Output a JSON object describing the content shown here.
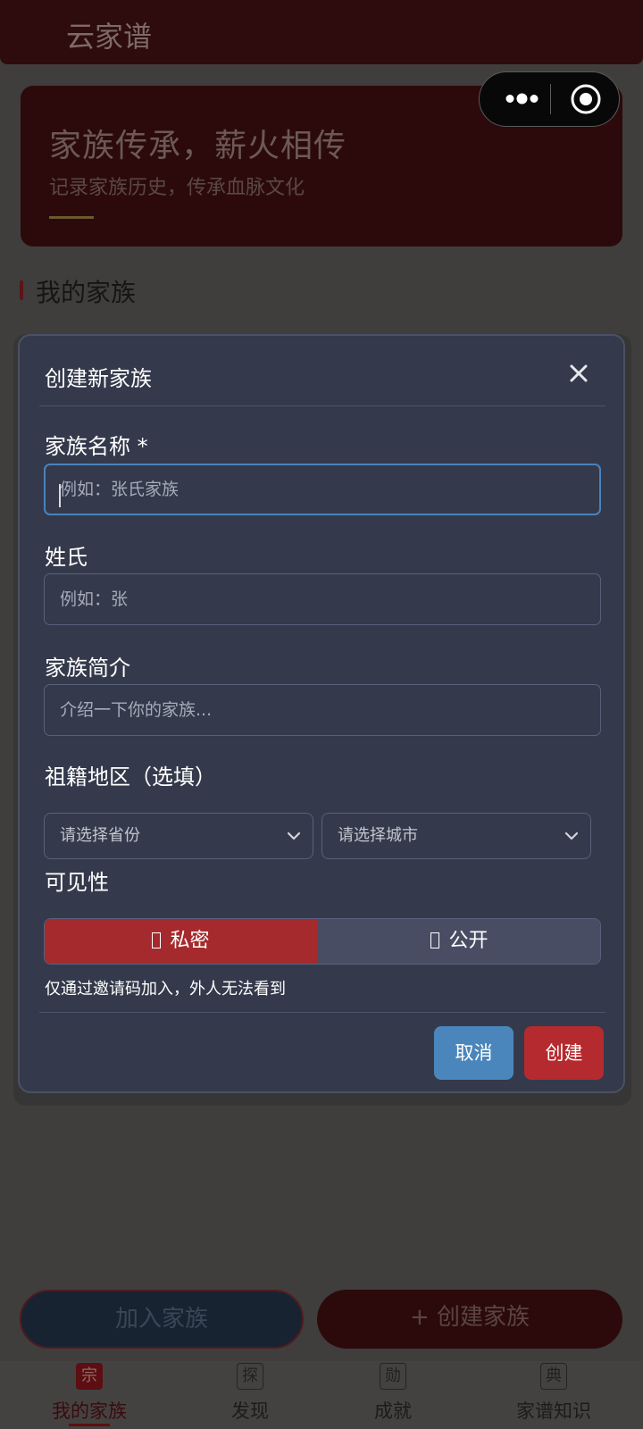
{
  "app": {
    "title": "云家谱"
  },
  "hero": {
    "title": "家族传承，薪火相传",
    "subtitle": "记录家族历史，传承血脉文化"
  },
  "section": {
    "title": "我的家族"
  },
  "modal": {
    "title": "创建新家族",
    "fields": {
      "name": {
        "label": "家族名称 *",
        "placeholder": "例如：张氏家族",
        "value": ""
      },
      "surname": {
        "label": "姓氏",
        "placeholder": "例如：张",
        "value": ""
      },
      "intro": {
        "label": "家族简介",
        "placeholder": "介绍一下你的家族...",
        "value": ""
      },
      "region": {
        "label": "祖籍地区（选填）",
        "province_placeholder": "请选择省份",
        "city_placeholder": "请选择城市"
      },
      "visibility": {
        "label": "可见性",
        "options": [
          "私密",
          "公开"
        ],
        "selected": "私密",
        "hint": "仅通过邀请码加入，外人无法看到"
      }
    },
    "buttons": {
      "cancel": "取消",
      "create": "创建"
    }
  },
  "actions": {
    "join": "加入家族",
    "create": "+ 创建家族"
  },
  "tabbar": {
    "active": 0,
    "items": [
      {
        "icon": "宗",
        "label": "我的家族"
      },
      {
        "icon": "探",
        "label": "发现"
      },
      {
        "icon": "勋",
        "label": "成就"
      },
      {
        "icon": "典",
        "label": "家谱知识"
      }
    ]
  },
  "colors": {
    "primary": "#a52a2d",
    "accent_blue": "#4a86bb",
    "modal_bg": "#343a4b"
  }
}
